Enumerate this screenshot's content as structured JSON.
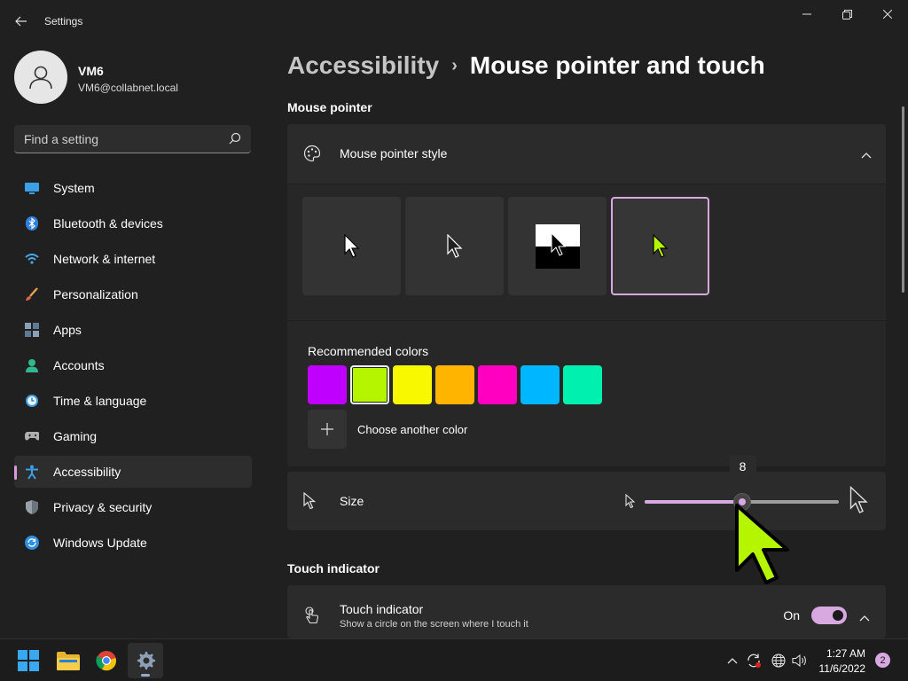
{
  "window": {
    "title": "Settings"
  },
  "user": {
    "name": "VM6",
    "email": "VM6@collabnet.local"
  },
  "search": {
    "placeholder": "Find a setting"
  },
  "sidebar": {
    "items": [
      {
        "label": "System",
        "icon": "system-icon",
        "active": false
      },
      {
        "label": "Bluetooth & devices",
        "icon": "bluetooth-icon",
        "active": false
      },
      {
        "label": "Network & internet",
        "icon": "wifi-icon",
        "active": false
      },
      {
        "label": "Personalization",
        "icon": "brush-icon",
        "active": false
      },
      {
        "label": "Apps",
        "icon": "apps-icon",
        "active": false
      },
      {
        "label": "Accounts",
        "icon": "person-icon",
        "active": false
      },
      {
        "label": "Time & language",
        "icon": "clock-globe-icon",
        "active": false
      },
      {
        "label": "Gaming",
        "icon": "gamepad-icon",
        "active": false
      },
      {
        "label": "Accessibility",
        "icon": "accessibility-icon",
        "active": true
      },
      {
        "label": "Privacy & security",
        "icon": "shield-icon",
        "active": false
      },
      {
        "label": "Windows Update",
        "icon": "update-icon",
        "active": false
      }
    ]
  },
  "breadcrumb": {
    "parent": "Accessibility",
    "separator": "›",
    "current": "Mouse pointer and touch"
  },
  "mouse_pointer": {
    "section_title": "Mouse pointer",
    "style_label": "Mouse pointer style",
    "styles": [
      "white",
      "black",
      "inverted",
      "custom"
    ],
    "selected_style": "custom",
    "recommended_label": "Recommended colors",
    "colors": [
      "#bf00ff",
      "#b5f500",
      "#f8f800",
      "#ffb400",
      "#ff00c0",
      "#00b7ff",
      "#00f0b0"
    ],
    "selected_color": "#b5f500",
    "choose_color_label": "Choose another color"
  },
  "size": {
    "label": "Size",
    "value": "8",
    "fraction": 0.5
  },
  "touch": {
    "section_title": "Touch indicator",
    "label": "Touch indicator",
    "description": "Show a circle on the screen where I touch it",
    "state": "On"
  },
  "taskbar": {
    "time": "1:27 AM",
    "date": "11/6/2022",
    "notifications": "2"
  },
  "colors": {
    "accent": "#d8a8e0",
    "background": "#202020",
    "card": "#2b2b2b"
  }
}
